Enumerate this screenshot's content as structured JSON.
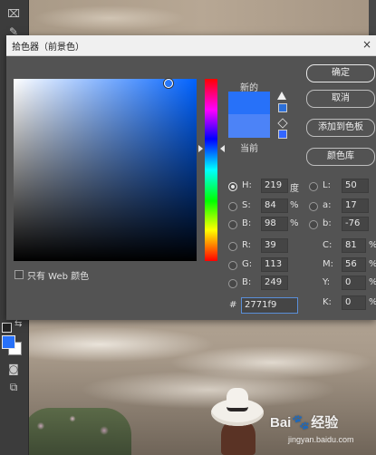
{
  "dialog": {
    "title": "拾色器（前景色）",
    "close_symbol": "×",
    "new_label": "新的",
    "current_label": "当前",
    "new_color": "#2771f9",
    "current_color": "#4c83f7",
    "buttons": {
      "ok": "确定",
      "cancel": "取消",
      "add_to_swatches": "添加到色板",
      "color_libraries": "颜色库"
    },
    "websafe_label": "只有 Web 颜色",
    "hsb": {
      "h_label": "H:",
      "h_value": "219",
      "h_unit": "度",
      "s_label": "S:",
      "s_value": "84",
      "s_unit": "%",
      "b_label": "B:",
      "b_value": "98",
      "b_unit": "%"
    },
    "rgb": {
      "r_label": "R:",
      "r_value": "39",
      "g_label": "G:",
      "g_value": "113",
      "b_label": "B:",
      "b_value": "249"
    },
    "lab": {
      "l_label": "L:",
      "l_value": "50",
      "a_label": "a:",
      "a_value": "17",
      "b_label": "b:",
      "b_value": "-76"
    },
    "cmyk": {
      "c_label": "C:",
      "c_value": "81",
      "c_unit": "%",
      "m_label": "M:",
      "m_value": "56",
      "m_unit": "%",
      "y_label": "Y:",
      "y_value": "0",
      "y_unit": "%",
      "k_label": "K:",
      "k_value": "0",
      "k_unit": "%"
    },
    "hex_label": "#",
    "hex_value": "2771f9"
  },
  "watermark": {
    "brand_a": "Bai",
    "paw": "🐾",
    "brand_b": "经验",
    "url": "jingyan.baidu.com"
  },
  "toolbar": {
    "tools": [
      "crop-icon",
      "eyedropper-icon"
    ],
    "foreground_color": "#2771f9",
    "background_color": "#ffffff"
  }
}
